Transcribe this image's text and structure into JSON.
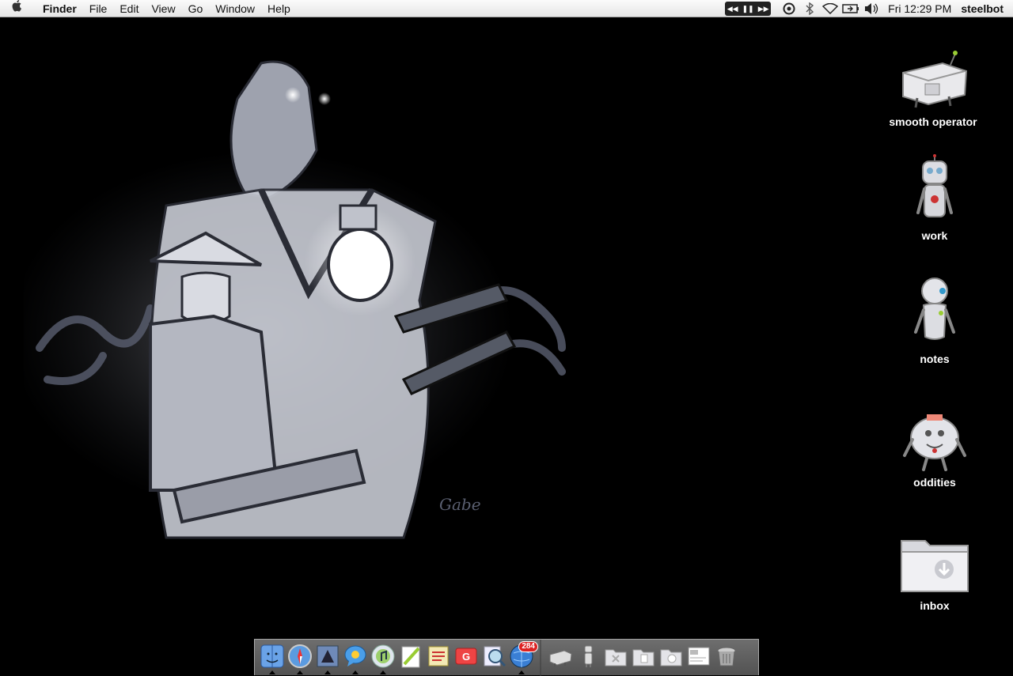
{
  "menubar": {
    "app_name": "Finder",
    "menus": [
      "File",
      "Edit",
      "View",
      "Go",
      "Window",
      "Help"
    ],
    "clock": "Fri 12:29 PM",
    "user": "steelbot",
    "status_icons": [
      "itunes-controls-icon",
      "sync-icon",
      "bluetooth-icon",
      "wifi-icon",
      "battery-icon",
      "volume-icon"
    ]
  },
  "wallpaper": {
    "signature": "Gabe"
  },
  "desktop_icons": [
    {
      "label": "smooth operator",
      "icon": "robot-drive-icon"
    },
    {
      "label": "work",
      "icon": "robot-folder-icon"
    },
    {
      "label": "notes",
      "icon": "robot-folder-icon"
    },
    {
      "label": "oddities",
      "icon": "robot-folder-icon"
    },
    {
      "label": "inbox",
      "icon": "folder-download-icon"
    }
  ],
  "dock": {
    "apps": [
      {
        "name": "Finder",
        "icon": "finder-icon",
        "running": true
      },
      {
        "name": "Safari",
        "icon": "safari-icon",
        "running": true
      },
      {
        "name": "Mail",
        "icon": "mail-icon",
        "running": true
      },
      {
        "name": "iChat",
        "icon": "ichat-icon",
        "running": true
      },
      {
        "name": "iTunes",
        "icon": "itunes-icon",
        "running": true
      },
      {
        "name": "TextEdit",
        "icon": "textedit-icon",
        "running": false
      },
      {
        "name": "Notes",
        "icon": "notes-icon",
        "running": false
      },
      {
        "name": "Gmail",
        "icon": "gmail-icon",
        "running": false
      },
      {
        "name": "Preview",
        "icon": "preview-icon",
        "running": false
      },
      {
        "name": "Network",
        "icon": "network-globe-icon",
        "running": true,
        "badge": "284"
      }
    ],
    "docs": [
      {
        "name": "smooth operator",
        "icon": "robot-drive-icon"
      },
      {
        "name": "work",
        "icon": "robot-folder-icon"
      },
      {
        "name": "Folder",
        "icon": "folder-x-icon"
      },
      {
        "name": "Folder",
        "icon": "folder-doc-icon"
      },
      {
        "name": "Folder",
        "icon": "folder-cd-icon"
      },
      {
        "name": "Screenshot",
        "icon": "screenshot-icon"
      },
      {
        "name": "Trash",
        "icon": "trash-icon"
      }
    ]
  }
}
